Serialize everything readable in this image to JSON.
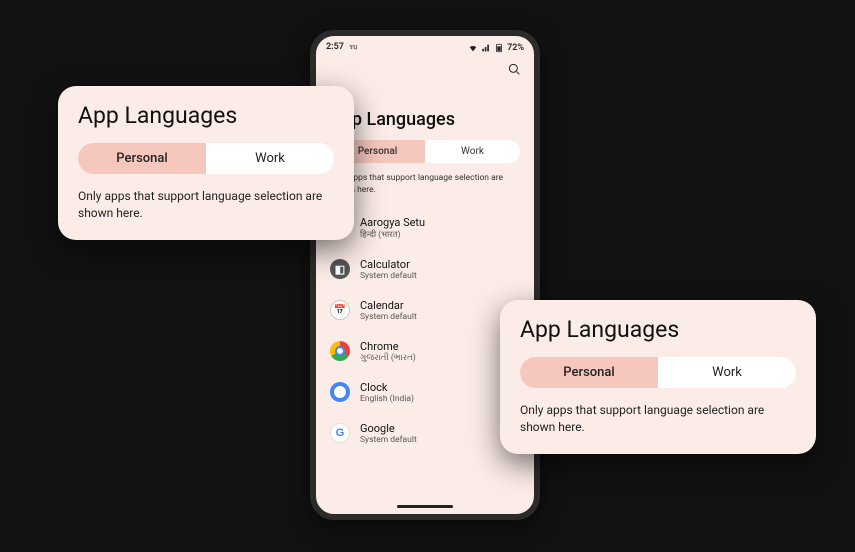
{
  "phone": {
    "statusbar": {
      "time": "2:57",
      "carrier": "รบ",
      "battery": "72%"
    },
    "title": "App Languages",
    "tabs": {
      "personal": "Personal",
      "work": "Work",
      "active": "personal"
    },
    "note": "Only apps that support language selection are shown here.",
    "apps": [
      {
        "name": "Aarogya Setu",
        "sub": "हिन्दी (भारत)",
        "icon": "aarogya"
      },
      {
        "name": "Calculator",
        "sub": "System default",
        "icon": "calculator"
      },
      {
        "name": "Calendar",
        "sub": "System default",
        "icon": "calendar"
      },
      {
        "name": "Chrome",
        "sub": "ગુજરાતી (ભારત)",
        "icon": "chrome"
      },
      {
        "name": "Clock",
        "sub": "English (India)",
        "icon": "clock"
      },
      {
        "name": "Google",
        "sub": "System default",
        "icon": "google"
      }
    ]
  },
  "card1": {
    "title": "App Languages",
    "tabs": {
      "personal": "Personal",
      "work": "Work"
    },
    "note": "Only apps that support language selection are shown here."
  },
  "card2": {
    "title": "App Languages",
    "tabs": {
      "personal": "Personal",
      "work": "Work"
    },
    "note": "Only apps that support language selection are shown here."
  }
}
